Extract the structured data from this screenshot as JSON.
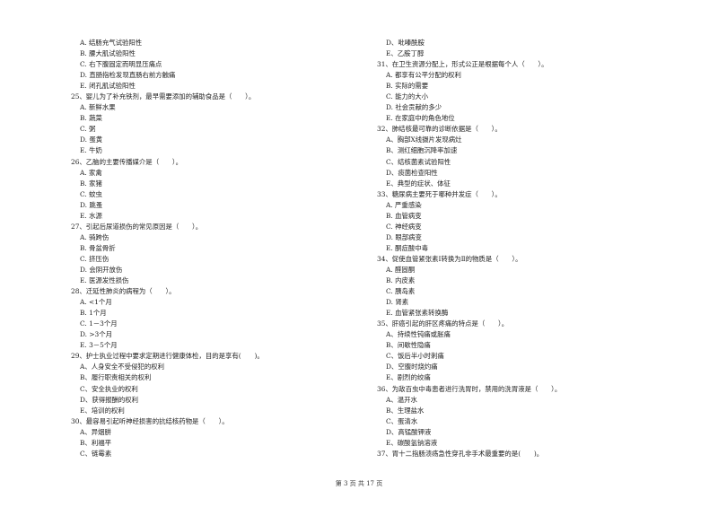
{
  "left_column": [
    {
      "type": "opt",
      "text": "A. 结肠充气试验阳性"
    },
    {
      "type": "opt",
      "text": "B. 腰大肌试验阳性"
    },
    {
      "type": "opt",
      "text": "C. 右下腹固定而明显压痛点"
    },
    {
      "type": "opt",
      "text": "D. 直肠指检发现直肠右前方触痛"
    },
    {
      "type": "opt",
      "text": "E. 闭孔肌试验阳性"
    },
    {
      "type": "q",
      "text": "25、婴儿为了补充铁剂，最早需要添加的辅助食品是（　　）。"
    },
    {
      "type": "opt",
      "text": "A. 新鲜水果"
    },
    {
      "type": "opt",
      "text": "B. 蔬菜"
    },
    {
      "type": "opt",
      "text": "C. 粥"
    },
    {
      "type": "opt",
      "text": "D. 蛋黄"
    },
    {
      "type": "opt",
      "text": "E. 牛奶"
    },
    {
      "type": "q",
      "text": "26、乙脑的主要传播媒介是（　　）。"
    },
    {
      "type": "opt",
      "text": "A. 家禽"
    },
    {
      "type": "opt",
      "text": "B. 家猪"
    },
    {
      "type": "opt",
      "text": "C. 蚊虫"
    },
    {
      "type": "opt",
      "text": "D. 跳蚤"
    },
    {
      "type": "opt",
      "text": "E. 水源"
    },
    {
      "type": "q",
      "text": "27、引起后尿道损伤的常见原因是（　　）。"
    },
    {
      "type": "opt",
      "text": "A. 骑跨伤"
    },
    {
      "type": "opt",
      "text": "B. 骨盆骨折"
    },
    {
      "type": "opt",
      "text": "C. 挤压伤"
    },
    {
      "type": "opt",
      "text": "D. 会阴开放伤"
    },
    {
      "type": "opt",
      "text": "E. 医源发性损伤"
    },
    {
      "type": "q",
      "text": "28、迁延性肺炎的病程为（　　）。"
    },
    {
      "type": "opt",
      "text": "A. <1个月"
    },
    {
      "type": "opt",
      "text": "B. 1个月"
    },
    {
      "type": "opt",
      "text": "C. 1－3个月"
    },
    {
      "type": "opt",
      "text": "D. >3个月"
    },
    {
      "type": "opt",
      "text": "E. 3－5个月"
    },
    {
      "type": "q",
      "text": "29、护士执业过程中要求定期进行健康体检，目的是享有(　　)。"
    },
    {
      "type": "opt",
      "text": "A、人身安全不受侵犯的权利"
    },
    {
      "type": "opt",
      "text": "B、履行职责相关的权利"
    },
    {
      "type": "opt",
      "text": "C、安全执业的权利"
    },
    {
      "type": "opt",
      "text": "D、获得报酬的权利"
    },
    {
      "type": "opt",
      "text": "E、培训的权利"
    },
    {
      "type": "q",
      "text": "30、最容易引起听神经损害的抗结核药物是（　　）。"
    },
    {
      "type": "opt",
      "text": "A、异烟肼"
    },
    {
      "type": "opt",
      "text": "B、利福平"
    },
    {
      "type": "opt",
      "text": "C、链霉素"
    }
  ],
  "right_column": [
    {
      "type": "opt",
      "text": "D、吡嗪酰胺"
    },
    {
      "type": "opt",
      "text": "E、乙胺丁醇"
    },
    {
      "type": "q",
      "text": "31、在卫生资源分配上，形式公正是根据每个人（　　）。"
    },
    {
      "type": "opt",
      "text": "A. 都享有公平分配的权利"
    },
    {
      "type": "opt",
      "text": "B. 实际的需要"
    },
    {
      "type": "opt",
      "text": "C. 能力的大小"
    },
    {
      "type": "opt",
      "text": "D. 社会贡献的多少"
    },
    {
      "type": "opt",
      "text": "E. 在家庭中的角色地位"
    },
    {
      "type": "q",
      "text": "32、肺结核最可靠的诊断依据是（　　）。"
    },
    {
      "type": "opt",
      "text": "A、胸部X线摄片发现病灶"
    },
    {
      "type": "opt",
      "text": "B、测红细胞沉降率加速"
    },
    {
      "type": "opt",
      "text": "C、结核菌素试验阳性"
    },
    {
      "type": "opt",
      "text": "D、痰菌检查阳性"
    },
    {
      "type": "opt",
      "text": "E、典型的症状、体征"
    },
    {
      "type": "q",
      "text": "33、糖尿病主要死于哪种并发症（　　）。"
    },
    {
      "type": "opt",
      "text": "A. 严重感染"
    },
    {
      "type": "opt",
      "text": "B. 血管病变"
    },
    {
      "type": "opt",
      "text": "C. 神经病变"
    },
    {
      "type": "opt",
      "text": "D. 眼部病变"
    },
    {
      "type": "opt",
      "text": "E. 酮症酸中毒"
    },
    {
      "type": "q",
      "text": "34、促使血管紧张素Ⅰ转换为Ⅱ的物质是（　　）。"
    },
    {
      "type": "opt",
      "text": "A. 醛固酮"
    },
    {
      "type": "opt",
      "text": "B. 内皮素"
    },
    {
      "type": "opt",
      "text": "C. 胰岛素"
    },
    {
      "type": "opt",
      "text": "D. 肾素"
    },
    {
      "type": "opt",
      "text": "E. 血管紧张素转换酶"
    },
    {
      "type": "q",
      "text": "35、肝癌引起的肝区疼痛的特点是（　　）。"
    },
    {
      "type": "opt",
      "text": "A、持续性钝痛或胀痛"
    },
    {
      "type": "opt",
      "text": "B、间歇性隐痛"
    },
    {
      "type": "opt",
      "text": "C、饭后半小时刺痛"
    },
    {
      "type": "opt",
      "text": "D、空腹时烧灼痛"
    },
    {
      "type": "opt",
      "text": "E、剧烈的绞痛"
    },
    {
      "type": "q",
      "text": "36、为敌百虫中毒患者进行洗胃时，禁用的洗胃液是（　　）。"
    },
    {
      "type": "opt",
      "text": "A、温开水"
    },
    {
      "type": "opt",
      "text": "B、生理盐水"
    },
    {
      "type": "opt",
      "text": "C、蛋清水"
    },
    {
      "type": "opt",
      "text": "D、高锰酸钾液"
    },
    {
      "type": "opt",
      "text": "E、碳酸氢钠溶液"
    },
    {
      "type": "q",
      "text": "37、胃十二指肠溃疡急性穿孔非手术最重要的是(　　)。"
    }
  ],
  "footer": {
    "page_label": "第 3 页 共 17 页"
  }
}
